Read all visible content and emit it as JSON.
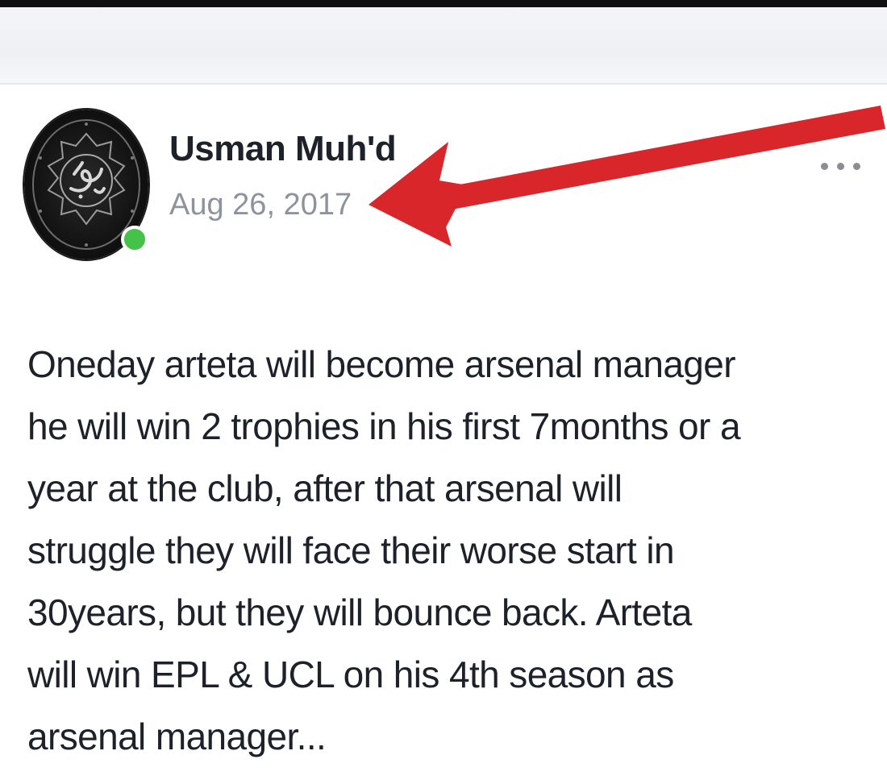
{
  "post": {
    "author_name": "Usman Muh'd",
    "date": "Aug 26, 2017",
    "avatar": {
      "icon": "calligraphy-emblem-icon",
      "online_status": "online"
    },
    "menu_icon": "more-options-icon",
    "body_lines": [
      "Oneday arteta will become arsenal manager",
      "he will win 2 trophies in his first 7months or a",
      "year at the club, after that arsenal will",
      "struggle they will face their worse start in",
      "30years, but they will bounce back. Arteta",
      "will win EPL & UCL on his 4th season as",
      "arsenal manager..."
    ]
  },
  "annotation": {
    "icon": "red-arrow-icon",
    "color": "#d9262b"
  },
  "colors": {
    "name": "#1d2129",
    "date": "#8d939c",
    "online": "#44c24a",
    "top_band": "#eef0f4"
  }
}
